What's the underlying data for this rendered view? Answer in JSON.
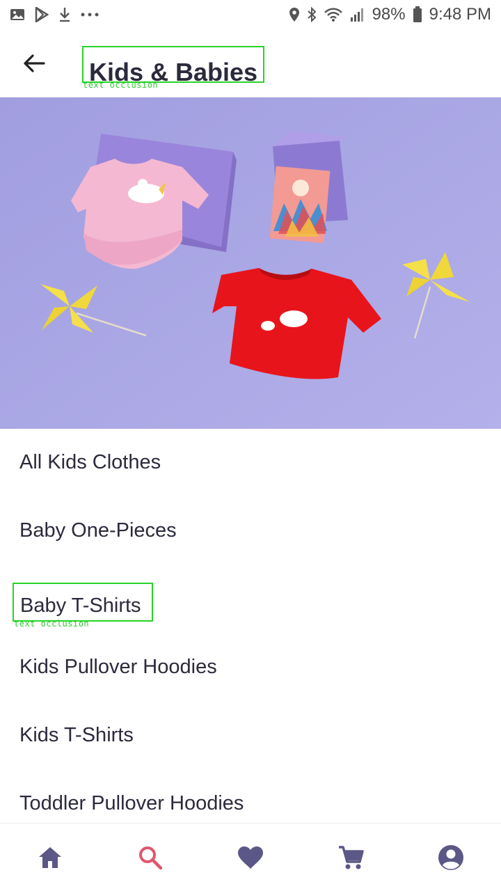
{
  "status_bar": {
    "battery": "98%",
    "time": "9:48 PM",
    "icons_left": [
      "gallery-icon",
      "play-store-icon",
      "download-icon",
      "more-icon"
    ],
    "icons_right": [
      "location-icon",
      "bluetooth-icon",
      "wifi-icon",
      "signal-icon",
      "battery-icon"
    ]
  },
  "header": {
    "title": "Kids & Babies",
    "occlusion_label": "text occlusion"
  },
  "hero": {
    "background_color": "#a9a6e4"
  },
  "categories": [
    {
      "label": "All Kids Clothes"
    },
    {
      "label": "Baby One-Pieces"
    },
    {
      "label": "Baby T-Shirts",
      "occlusion_label": "text occlusion"
    },
    {
      "label": "Kids Pullover Hoodies"
    },
    {
      "label": "Kids T-Shirts"
    },
    {
      "label": "Toddler Pullover Hoodies"
    }
  ],
  "bottom_nav": {
    "items": [
      "home-icon",
      "search-icon",
      "heart-icon",
      "cart-icon",
      "account-icon"
    ],
    "active": "search-icon",
    "colors": {
      "default": "#5b5887",
      "active": "#e0566b"
    }
  }
}
